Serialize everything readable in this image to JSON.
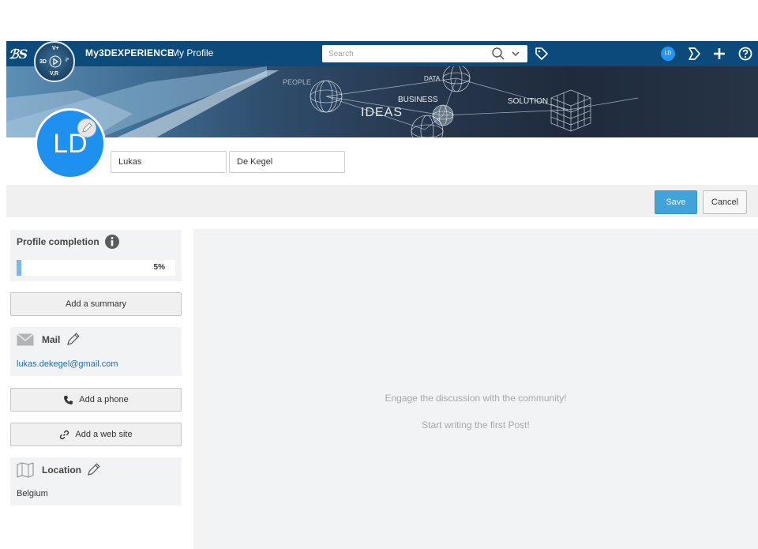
{
  "topbar": {
    "brand": "3DS",
    "compass": {
      "top": "V+",
      "left": "3D",
      "right": "i²",
      "bottom": "V,R"
    },
    "app_title": "My3DEXPERIENCE",
    "app_subtitle": "My Profile",
    "search_placeholder": "Search",
    "user_initials": "LD",
    "colors": {
      "bar": "#0b4a7a",
      "avatar": "#2196f3"
    },
    "icons": [
      "search-icon",
      "chevron-down-icon",
      "tag-icon",
      "share-icon",
      "plus-icon",
      "help-icon"
    ]
  },
  "banner": {
    "words": [
      "PEOPLE",
      "DATA",
      "BUSINESS",
      "SOLUTION",
      "IDEAS"
    ]
  },
  "profile": {
    "initials": "LD",
    "first_name": "Lukas",
    "last_name": "De Kegel",
    "avatar_color": "#1e90f0"
  },
  "actions": {
    "save": "Save",
    "cancel": "Cancel",
    "save_color": "#42a2da"
  },
  "sidebar": {
    "completion": {
      "title": "Profile completion",
      "percent_label": "5%",
      "fraction": 0.05
    },
    "add_summary": "Add a summary",
    "mail": {
      "title": "Mail",
      "value": "lukas.dekegel@gmail.com",
      "link_color": "#1f6fb2"
    },
    "add_phone": "Add a phone",
    "add_website": "Add a web site",
    "location": {
      "title": "Location",
      "value": "Belgium"
    }
  },
  "feed": {
    "line1": "Engage the discussion with the community!",
    "line2": "Start writing the first Post!"
  }
}
